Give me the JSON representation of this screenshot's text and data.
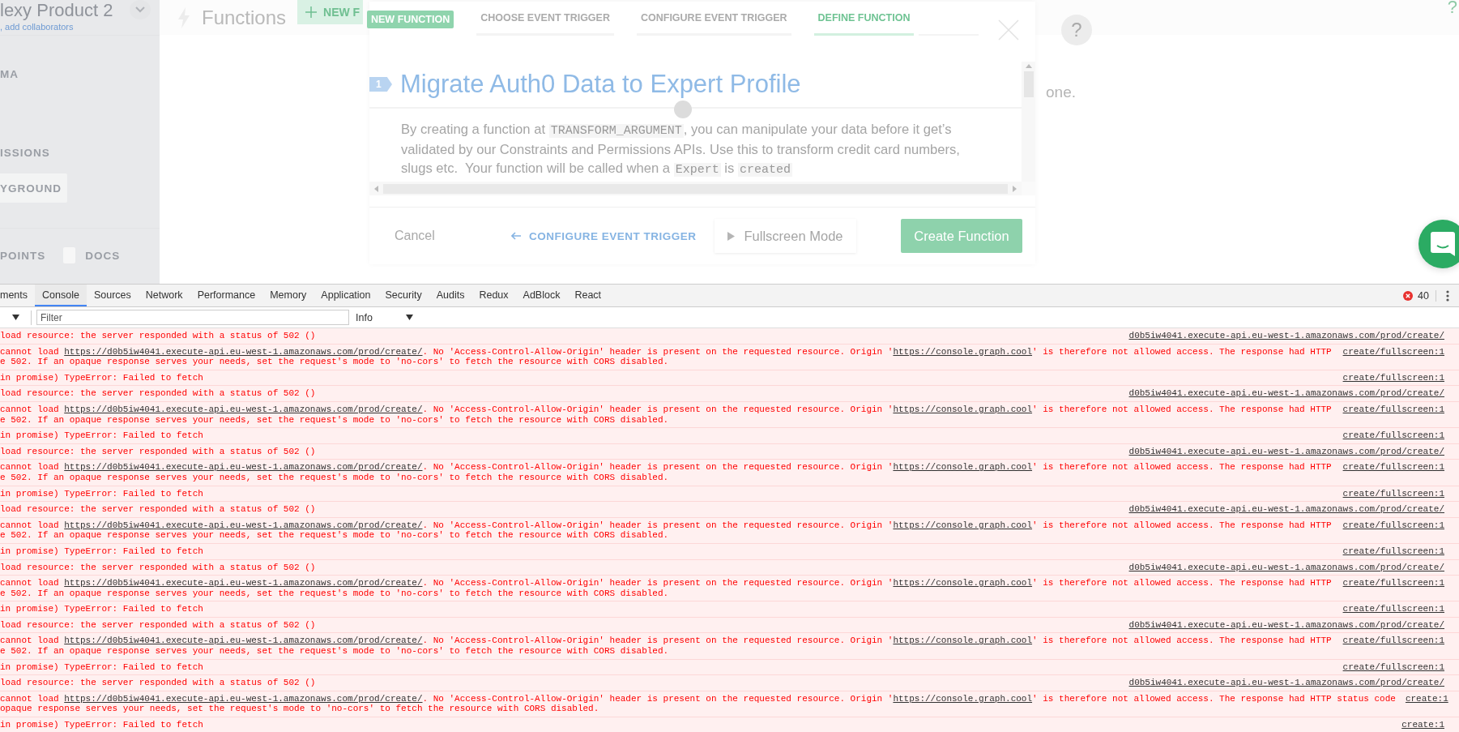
{
  "sidebar": {
    "project": "lexy Product 2",
    "subtitle": ", add collaborators",
    "items": [
      {
        "label": "MA",
        "kind": "text"
      },
      {
        "label": "ISSIONS",
        "kind": "text"
      },
      {
        "label": "YGROUND",
        "kind": "button"
      }
    ],
    "footer": [
      {
        "label": "POINTS",
        "kind": "text"
      },
      {
        "label": "DOCS",
        "kind": "doc"
      }
    ]
  },
  "header": {
    "title": "Functions",
    "new_button": "NEW F",
    "help": "?",
    "corner_help": "?"
  },
  "page_text": "one.",
  "modal": {
    "badge": "NEW FUNCTION",
    "tabs": [
      {
        "label": "CHOOSE EVENT TRIGGER",
        "selected": false
      },
      {
        "label": "CONFIGURE EVENT TRIGGER",
        "selected": false
      },
      {
        "label": "DEFINE FUNCTION",
        "selected": true
      }
    ],
    "step": "1",
    "title": "Migrate Auth0 Data to Expert Profile",
    "description": [
      {
        "text": "By creating a function at ",
        "code": false
      },
      {
        "text": "TRANSFORM_ARGUMENT",
        "code": true
      },
      {
        "text": ", you can manipulate your data before it get’s validated by our Constraints and Permissions APIs. Use this to transform credit card numbers, slugs etc.  Your function will be called when a ",
        "code": false
      },
      {
        "text": "Expert",
        "code": true
      },
      {
        "text": " is ",
        "code": false
      },
      {
        "text": "created",
        "code": true
      }
    ],
    "cancel": "Cancel",
    "back": "CONFIGURE EVENT TRIGGER",
    "fullscreen": "Fullscreen Mode",
    "create": "Create Function"
  },
  "devtools": {
    "tabs": [
      {
        "label": "ments",
        "selected": false
      },
      {
        "label": "Console",
        "selected": true
      },
      {
        "label": "Sources",
        "selected": false
      },
      {
        "label": "Network",
        "selected": false
      },
      {
        "label": "Performance",
        "selected": false
      },
      {
        "label": "Memory",
        "selected": false
      },
      {
        "label": "Application",
        "selected": false
      },
      {
        "label": "Security",
        "selected": false
      },
      {
        "label": "Audits",
        "selected": false
      },
      {
        "label": "Redux",
        "selected": false
      },
      {
        "label": "AdBlock",
        "selected": false
      },
      {
        "label": "React",
        "selected": false
      }
    ],
    "error_count": "40",
    "filter": {
      "placeholder": "Filter"
    },
    "level": "Info",
    "messages": [
      {
        "lines": [
          [
            {
              "text": "load resource: the server responded with a status of 502 ()",
              "link": false
            }
          ]
        ],
        "source": "d0b5iw4041.execute-api.eu-west-1.amazonaws.com/prod/create/"
      },
      {
        "lines": [
          [
            {
              "text": "cannot load ",
              "link": false
            },
            {
              "text": "https://d0b5iw4041.execute-api.eu-west-1.amazonaws.com/prod/create/",
              "link": true
            },
            {
              "text": ". No 'Access-Control-Allow-Origin' header is present on the requested resource. Origin '",
              "link": false
            },
            {
              "text": "https://console.graph.cool",
              "link": true
            },
            {
              "text": "' is therefore not allowed access. The response had HTTP",
              "link": false
            }
          ],
          [
            {
              "text": "e 502. If an opaque response serves your needs, set the request's mode to 'no-cors' to fetch the resource with CORS disabled.",
              "link": false
            }
          ]
        ],
        "source": "create/fullscreen:1"
      },
      {
        "lines": [
          [
            {
              "text": "in promise) TypeError: Failed to fetch",
              "link": false
            }
          ]
        ],
        "source": "create/fullscreen:1"
      },
      {
        "lines": [
          [
            {
              "text": "load resource: the server responded with a status of 502 ()",
              "link": false
            }
          ]
        ],
        "source": "d0b5iw4041.execute-api.eu-west-1.amazonaws.com/prod/create/"
      },
      {
        "lines": [
          [
            {
              "text": "cannot load ",
              "link": false
            },
            {
              "text": "https://d0b5iw4041.execute-api.eu-west-1.amazonaws.com/prod/create/",
              "link": true
            },
            {
              "text": ". No 'Access-Control-Allow-Origin' header is present on the requested resource. Origin '",
              "link": false
            },
            {
              "text": "https://console.graph.cool",
              "link": true
            },
            {
              "text": "' is therefore not allowed access. The response had HTTP",
              "link": false
            }
          ],
          [
            {
              "text": "e 502. If an opaque response serves your needs, set the request's mode to 'no-cors' to fetch the resource with CORS disabled.",
              "link": false
            }
          ]
        ],
        "source": "create/fullscreen:1"
      },
      {
        "lines": [
          [
            {
              "text": "in promise) TypeError: Failed to fetch",
              "link": false
            }
          ]
        ],
        "source": "create/fullscreen:1"
      },
      {
        "lines": [
          [
            {
              "text": "load resource: the server responded with a status of 502 ()",
              "link": false
            }
          ]
        ],
        "source": "d0b5iw4041.execute-api.eu-west-1.amazonaws.com/prod/create/"
      },
      {
        "lines": [
          [
            {
              "text": "cannot load ",
              "link": false
            },
            {
              "text": "https://d0b5iw4041.execute-api.eu-west-1.amazonaws.com/prod/create/",
              "link": true
            },
            {
              "text": ". No 'Access-Control-Allow-Origin' header is present on the requested resource. Origin '",
              "link": false
            },
            {
              "text": "https://console.graph.cool",
              "link": true
            },
            {
              "text": "' is therefore not allowed access. The response had HTTP",
              "link": false
            }
          ],
          [
            {
              "text": "e 502. If an opaque response serves your needs, set the request's mode to 'no-cors' to fetch the resource with CORS disabled.",
              "link": false
            }
          ]
        ],
        "source": "create/fullscreen:1"
      },
      {
        "lines": [
          [
            {
              "text": "in promise) TypeError: Failed to fetch",
              "link": false
            }
          ]
        ],
        "source": "create/fullscreen:1"
      },
      {
        "lines": [
          [
            {
              "text": "load resource: the server responded with a status of 502 ()",
              "link": false
            }
          ]
        ],
        "source": "d0b5iw4041.execute-api.eu-west-1.amazonaws.com/prod/create/"
      },
      {
        "lines": [
          [
            {
              "text": "cannot load ",
              "link": false
            },
            {
              "text": "https://d0b5iw4041.execute-api.eu-west-1.amazonaws.com/prod/create/",
              "link": true
            },
            {
              "text": ". No 'Access-Control-Allow-Origin' header is present on the requested resource. Origin '",
              "link": false
            },
            {
              "text": "https://console.graph.cool",
              "link": true
            },
            {
              "text": "' is therefore not allowed access. The response had HTTP",
              "link": false
            }
          ],
          [
            {
              "text": "e 502. If an opaque response serves your needs, set the request's mode to 'no-cors' to fetch the resource with CORS disabled.",
              "link": false
            }
          ]
        ],
        "source": "create/fullscreen:1"
      },
      {
        "lines": [
          [
            {
              "text": "in promise) TypeError: Failed to fetch",
              "link": false
            }
          ]
        ],
        "source": "create/fullscreen:1"
      },
      {
        "lines": [
          [
            {
              "text": "load resource: the server responded with a status of 502 ()",
              "link": false
            }
          ]
        ],
        "source": "d0b5iw4041.execute-api.eu-west-1.amazonaws.com/prod/create/"
      },
      {
        "lines": [
          [
            {
              "text": "cannot load ",
              "link": false
            },
            {
              "text": "https://d0b5iw4041.execute-api.eu-west-1.amazonaws.com/prod/create/",
              "link": true
            },
            {
              "text": ". No 'Access-Control-Allow-Origin' header is present on the requested resource. Origin '",
              "link": false
            },
            {
              "text": "https://console.graph.cool",
              "link": true
            },
            {
              "text": "' is therefore not allowed access. The response had HTTP",
              "link": false
            }
          ],
          [
            {
              "text": "e 502. If an opaque response serves your needs, set the request's mode to 'no-cors' to fetch the resource with CORS disabled.",
              "link": false
            }
          ]
        ],
        "source": "create/fullscreen:1"
      },
      {
        "lines": [
          [
            {
              "text": "in promise) TypeError: Failed to fetch",
              "link": false
            }
          ]
        ],
        "source": "create/fullscreen:1"
      },
      {
        "lines": [
          [
            {
              "text": "load resource: the server responded with a status of 502 ()",
              "link": false
            }
          ]
        ],
        "source": "d0b5iw4041.execute-api.eu-west-1.amazonaws.com/prod/create/"
      },
      {
        "lines": [
          [
            {
              "text": "cannot load ",
              "link": false
            },
            {
              "text": "https://d0b5iw4041.execute-api.eu-west-1.amazonaws.com/prod/create/",
              "link": true
            },
            {
              "text": ". No 'Access-Control-Allow-Origin' header is present on the requested resource. Origin '",
              "link": false
            },
            {
              "text": "https://console.graph.cool",
              "link": true
            },
            {
              "text": "' is therefore not allowed access. The response had HTTP",
              "link": false
            }
          ],
          [
            {
              "text": "e 502. If an opaque response serves your needs, set the request's mode to 'no-cors' to fetch the resource with CORS disabled.",
              "link": false
            }
          ]
        ],
        "source": "create/fullscreen:1"
      },
      {
        "lines": [
          [
            {
              "text": "in promise) TypeError: Failed to fetch",
              "link": false
            }
          ]
        ],
        "source": "create/fullscreen:1"
      },
      {
        "lines": [
          [
            {
              "text": "load resource: the server responded with a status of 502 ()",
              "link": false
            }
          ]
        ],
        "source": "d0b5iw4041.execute-api.eu-west-1.amazonaws.com/prod/create/"
      },
      {
        "lines": [
          [
            {
              "text": "cannot load ",
              "link": false
            },
            {
              "text": "https://d0b5iw4041.execute-api.eu-west-1.amazonaws.com/prod/create/",
              "link": true
            },
            {
              "text": ". No 'Access-Control-Allow-Origin' header is present on the requested resource. Origin '",
              "link": false
            },
            {
              "text": "https://console.graph.cool",
              "link": true
            },
            {
              "text": "' is therefore not allowed access. The response had HTTP status code",
              "link": false
            }
          ],
          [
            {
              "text": "opaque response serves your needs, set the request's mode to 'no-cors' to fetch the resource with CORS disabled.",
              "link": false
            }
          ]
        ],
        "source": "create:1"
      },
      {
        "lines": [
          [
            {
              "text": "in promise) TypeError: Failed to fetch",
              "link": false
            }
          ]
        ],
        "source": "create:1"
      }
    ]
  }
}
